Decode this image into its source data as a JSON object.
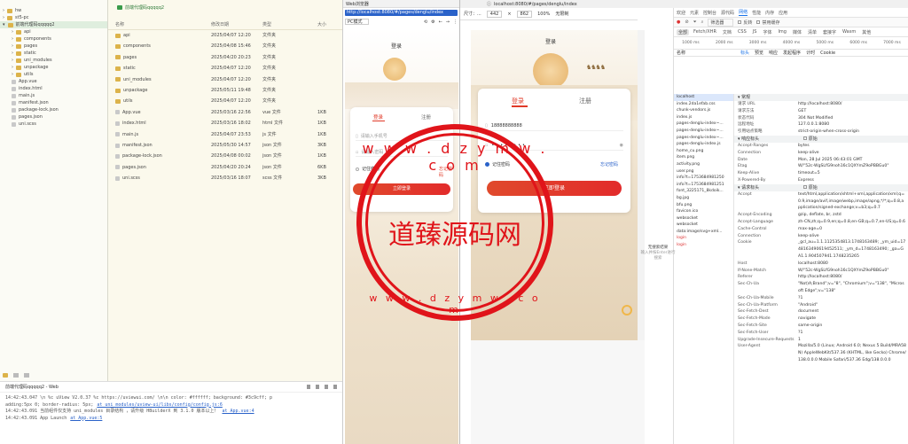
{
  "tree": {
    "items": [
      {
        "label": "hw",
        "type": "folder",
        "indent": 0,
        "open": false
      },
      {
        "label": "st5-pc",
        "type": "folder",
        "indent": 0,
        "open": false
      },
      {
        "label": "前端代理码qqqqq2",
        "type": "folder",
        "indent": 0,
        "open": true,
        "selected": true
      },
      {
        "label": "api",
        "type": "folder",
        "indent": 1
      },
      {
        "label": "components",
        "type": "folder",
        "indent": 1
      },
      {
        "label": "pages",
        "type": "folder",
        "indent": 1
      },
      {
        "label": "static",
        "type": "folder",
        "indent": 1
      },
      {
        "label": "uni_modules",
        "type": "folder",
        "indent": 1
      },
      {
        "label": "unpackage",
        "type": "folder",
        "indent": 1
      },
      {
        "label": "utils",
        "type": "folder",
        "indent": 1
      },
      {
        "label": "App.vue",
        "type": "file",
        "indent": 1
      },
      {
        "label": "index.html",
        "type": "file",
        "indent": 1
      },
      {
        "label": "main.js",
        "type": "file",
        "indent": 1
      },
      {
        "label": "manifest.json",
        "type": "file",
        "indent": 1
      },
      {
        "label": "package-lock.json",
        "type": "file",
        "indent": 1
      },
      {
        "label": "pages.json",
        "type": "file",
        "indent": 1
      },
      {
        "label": "uni.scss",
        "type": "file",
        "indent": 1
      }
    ]
  },
  "files": {
    "folder_title": "前端代理码qqqqq2",
    "headers": [
      "名称",
      "修改日期",
      "类型",
      "大小"
    ],
    "rows": [
      [
        "api",
        "2025/04/07 12:20",
        "文件夹",
        ""
      ],
      [
        "components",
        "2025/04/08 15:46",
        "文件夹",
        ""
      ],
      [
        "pages",
        "2025/04/20 20:23",
        "文件夹",
        ""
      ],
      [
        "static",
        "2025/04/07 12:20",
        "文件夹",
        ""
      ],
      [
        "uni_modules",
        "2025/04/07 12:20",
        "文件夹",
        ""
      ],
      [
        "unpackage",
        "2025/05/11 19:48",
        "文件夹",
        ""
      ],
      [
        "utils",
        "2025/04/07 12:20",
        "文件夹",
        ""
      ],
      [
        "App.vue",
        "2025/03/16 22:56",
        "vue 文件",
        "1KB"
      ],
      [
        "index.html",
        "2025/03/16 18:02",
        "html 文件",
        "1KB"
      ],
      [
        "main.js",
        "2025/04/07 23:53",
        "js 文件",
        "1KB"
      ],
      [
        "manifest.json",
        "2025/05/30 14:57",
        "json 文件",
        "3KB"
      ],
      [
        "package-lock.json",
        "2025/04/08 00:02",
        "json 文件",
        "1KB"
      ],
      [
        "pages.json",
        "2025/04/20 20:24",
        "json 文件",
        "6KB"
      ],
      [
        "uni.scss",
        "2025/03/16 18:07",
        "scss 文件",
        "3KB"
      ]
    ]
  },
  "console": {
    "title": "前端代理码qqqqq2 - Web",
    "lines": [
      {
        "text": "14:42:43.047 \\n %c uView V2.0.37 %c https://uviewui.com/ \\n\\n color: #ffffff; background: #3c9cff; p",
        "link": ""
      },
      {
        "text": "adding:5px 0; border-radius: 5px;",
        "link": "at uni_modules/uview-ui/libs/config/config.js:6"
      },
      {
        "text": "14:42:43.091 当前组件仅支持 uni_modules 目录结构 ，请升级 HBuilderX 到 3.1.0 版本以上！",
        "link": "at App.vue:4"
      },
      {
        "text": "14:42:43.091 App Launch",
        "link": "at App.vue:5"
      }
    ]
  },
  "preview": {
    "tab_label": "Web浏览器",
    "url": "http://localhost:8080/#/pages/denglu/index",
    "mode": "PC模式",
    "page_title": "登录",
    "tab_login": "登录",
    "tab_register": "注册",
    "phone_placeholder": "请输入手机号",
    "password_placeholder": "请输入密码",
    "remember": "记住密码",
    "forgot": "忘记密码",
    "login_button": "立即登录"
  },
  "devtools": {
    "url": "localhost:8080/#/pages/denglu/index",
    "device": "尺寸：...",
    "width": "442",
    "height": "862",
    "zoom": "100%",
    "throttle": "无限制",
    "tabs": [
      "欢迎",
      "元素",
      "控制台",
      "源代码",
      "网络",
      "性能",
      "内存",
      "应用"
    ],
    "active_tab": "网络",
    "filter_types": [
      "全部",
      "Fetch/XHR",
      "文档",
      "CSS",
      "JS",
      "字体",
      "Img",
      "媒体",
      "清单",
      "套接字",
      "Wasm",
      "其他"
    ],
    "sub_tabs": [
      "标头",
      "预览",
      "响应",
      "发起程序",
      "计时",
      "Cookie"
    ],
    "timeline": [
      "1000 ms",
      "2000 ms",
      "3000 ms",
      "4000 ms",
      "5000 ms",
      "6000 ms",
      "7000 ms"
    ],
    "requests": [
      "localhost",
      "index.2da1efab.css",
      "chunk-vendors.js",
      "index.js",
      "pages-denglu-index~...",
      "pages-denglu-index~...",
      "pages-denglu-index~...",
      "pages-denglu-index.js",
      "home_cu.png",
      "item.png",
      "activity.png",
      "user.png",
      "info?t=1753684981250",
      "info?t=1753684981251",
      "font_3225171_8kdoik...",
      "bg.jpg",
      "bfu.png",
      "favicon.ico",
      "websocket",
      "websocket",
      "data:image/svg+xml...",
      "login",
      "login"
    ],
    "name_col": "名称",
    "no_search": "无搜索结果",
    "search_hint": "输入并按Enter进行搜索",
    "general_title": "常规",
    "general": [
      [
        "请求 URL",
        "http://localhost:8080/"
      ],
      [
        "请求方法",
        "GET"
      ],
      [
        "状态代码",
        "304 Not Modified"
      ],
      [
        "远程地址",
        "127.0.0.1:8080"
      ],
      [
        "引用站点策略",
        "strict-origin-when-cross-origin"
      ]
    ],
    "resp_title": "响应标头",
    "resp": [
      [
        "Accept-Ranges",
        "bytes"
      ],
      [
        "Connection",
        "keep-alive"
      ],
      [
        "Date",
        "Mon, 28 Jul 2025 06:43:01 GMT"
      ],
      [
        "Etag",
        "W/\"52c-WgSLfG9noh16c1QXYmZ9oPBBGu0\""
      ],
      [
        "Keep-Alive",
        "timeout=5"
      ],
      [
        "X-Powered-By",
        "Express"
      ]
    ],
    "req_title": "请求标头",
    "req": [
      [
        "Accept",
        "text/html,application/xhtml+xml,application/xml;q=0.9,image/avif,image/webp,image/apng,*/*;q=0.8,application/signed-exchange;v=b3;q=0.7"
      ],
      [
        "Accept-Encoding",
        "gzip, deflate, br, zstd"
      ],
      [
        "Accept-Language",
        "zh-CN,zh;q=0.9,en;q=0.8,en-GB;q=0.7,en-US;q=0.6"
      ],
      [
        "Cache-Control",
        "max-age=0"
      ],
      [
        "Connection",
        "keep-alive"
      ],
      [
        "Cookie",
        "_gcl_au=1.1.1125354813.1748163489; _ym_uid=1748163490619452511; _ym_d=1748163490; _ga=GA1.1.904507941.1748235265"
      ],
      [
        "Host",
        "localhost:8080"
      ],
      [
        "If-None-Match",
        "W/\"52c-WgSLfG9noh16c1QXYmZ9oPBBGu0\""
      ],
      [
        "Referer",
        "http://localhost:8080/"
      ],
      [
        "Sec-Ch-Ua",
        "\"Not)A;Brand\";v=\"8\", \"Chromium\";v=\"138\", \"Microsoft Edge\";v=\"138\""
      ],
      [
        "Sec-Ch-Ua-Mobile",
        "?1"
      ],
      [
        "Sec-Ch-Ua-Platform",
        "\"Android\""
      ],
      [
        "Sec-Fetch-Dest",
        "document"
      ],
      [
        "Sec-Fetch-Mode",
        "navigate"
      ],
      [
        "Sec-Fetch-Site",
        "same-origin"
      ],
      [
        "Sec-Fetch-User",
        "?1"
      ],
      [
        "Upgrade-Insecure-Requests",
        "1"
      ],
      [
        "User-Agent",
        "Mozilla/5.0 (Linux; Android 6.0; Nexus 5 Build/MRA58N) AppleWebKit/537.36 (KHTML, like Gecko) Chrome/138.0.0.0 Mobile Safari/537.36 Edg/138.0.0.0"
      ]
    ],
    "raw_label": "原始",
    "filter_label": "筛选器",
    "disable_cache": "禁用缓存",
    "invert": "反转",
    "hide_data": "隐藏数据 URL",
    "third_party": "第三方请求",
    "blocked": "阻止的请求"
  },
  "center_phone": {
    "title": "登录",
    "tab_login": "登录",
    "tab_register": "注册",
    "phone_value": "18888888888",
    "password_value": "••••••••",
    "remember": "记住密码",
    "forgot": "忘记密码",
    "login_button": "立即登录"
  },
  "watermark": {
    "text": "道臻源码网",
    "letters": "w w w . d z y m w . c o m"
  },
  "colors": {
    "accent_red": "#e03a28",
    "folder_yellow": "#dcb34a",
    "link_blue": "#2a62c9",
    "devtools_blue": "#1a73e8"
  }
}
